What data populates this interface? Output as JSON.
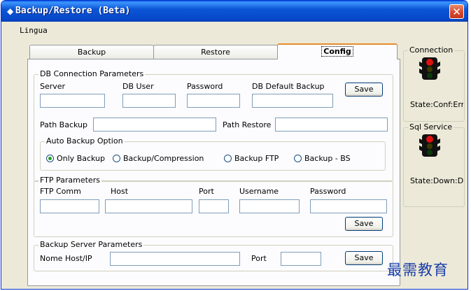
{
  "window": {
    "title": "Backup/Restore (Beta)",
    "close_label": "✕"
  },
  "menu": {
    "items": [
      "Lingua"
    ]
  },
  "tabs": [
    {
      "label": "Backup",
      "active": false
    },
    {
      "label": "Restore",
      "active": false
    },
    {
      "label": "Config",
      "active": true
    }
  ],
  "db_connection": {
    "legend": "DB Connection Parameters",
    "server_label": "Server",
    "server_value": "",
    "db_user_label": "DB User",
    "db_user_value": "",
    "password_label": "Password",
    "password_value": "",
    "default_backup_label": "DB Default Backup",
    "default_backup_value": "",
    "save_label": "Save",
    "path_backup_label": "Path Backup",
    "path_backup_value": "",
    "path_restore_label": "Path Restore",
    "path_restore_value": ""
  },
  "auto_backup": {
    "legend": "Auto Backup Option",
    "options": [
      {
        "label": "Only Backup",
        "selected": true
      },
      {
        "label": "Backup/Compression",
        "selected": false
      },
      {
        "label": "Backup FTP",
        "selected": false
      },
      {
        "label": "Backup - BS",
        "selected": false
      }
    ]
  },
  "ftp": {
    "legend": "FTP Parameters",
    "comm_label": "FTP Comm",
    "comm_value": "",
    "host_label": "Host",
    "host_value": "",
    "port_label": "Port",
    "port_value": "",
    "username_label": "Username",
    "username_value": "",
    "password_label": "Password",
    "password_value": "",
    "save_label": "Save"
  },
  "backup_server": {
    "legend": "Backup Server Parameters",
    "host_label": "Nome Host/IP",
    "host_value": "",
    "port_label": "Port",
    "port_value": "",
    "save_label": "Save"
  },
  "connection_panel": {
    "legend": "Connection",
    "state": "State:Conf:Err",
    "light_color": "#e01010",
    "icon": "traffic-light-icon"
  },
  "sql_service_panel": {
    "legend": "Sql Service",
    "state": "State:Down:D",
    "light_color": "#e01010",
    "icon": "traffic-light-icon"
  },
  "watermark": "最需教育"
}
